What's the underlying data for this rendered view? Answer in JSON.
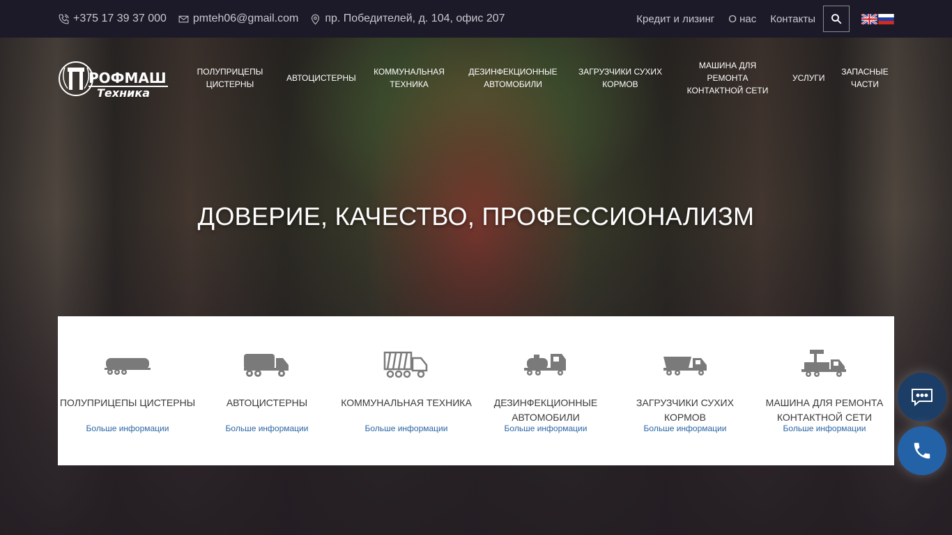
{
  "topbar": {
    "phone": "+375 17 39 37 000",
    "email": "pmteh06@gmail.com",
    "address": "пр. Победителей, д. 104, офис 207",
    "links": [
      "Кредит и лизинг",
      "О нас",
      "Контакты"
    ]
  },
  "nav": {
    "items": [
      "ПОЛУПРИЦЕПЫ ЦИСТЕРНЫ",
      "АВТОЦИСТЕРНЫ",
      "КОММУНАЛЬНАЯ ТЕХНИКА",
      "ДЕЗИНФЕКЦИОННЫЕ АВТОМОБИЛИ",
      "ЗАГРУЗЧИКИ СУХИХ КОРМОВ",
      "МАШИНА ДЛЯ РЕМОНТА КОНТАКТНОЙ СЕТИ",
      "УСЛУГИ",
      "ЗАПАСНЫЕ ЧАСТИ"
    ]
  },
  "logo": {
    "text_top": "РОФМАШ",
    "text_bottom": "Техника"
  },
  "hero": {
    "headline": "ДОВЕРИЕ, КАЧЕСТВО, ПРОФЕССИОНАЛИЗМ"
  },
  "categories": [
    {
      "title": "ПОЛУПРИЦЕПЫ ЦИСТЕРНЫ",
      "more": "Больше информации",
      "icon": "semi-trailer-tanker-icon"
    },
    {
      "title": "АВТОЦИСТЕРНЫ",
      "more": "Больше информации",
      "icon": "tanker-truck-icon"
    },
    {
      "title": "КОММУНАЛЬНАЯ ТЕХНИКА",
      "more": "Больше информации",
      "icon": "garbage-truck-icon"
    },
    {
      "title": "ДЕЗИНФЕКЦИОННЫЕ АВТОМОБИЛИ",
      "more": "Больше информации",
      "icon": "disinfection-truck-icon"
    },
    {
      "title": "ЗАГРУЗЧИКИ СУХИХ КОРМОВ",
      "more": "Больше информации",
      "icon": "feed-loader-truck-icon"
    },
    {
      "title": "МАШИНА ДЛЯ РЕМОНТА КОНТАКТНОЙ СЕТИ",
      "more": "Больше информации",
      "icon": "repair-platform-truck-icon"
    }
  ],
  "colors": {
    "topbar_bg": "#1c1a28",
    "link_blue": "#2a65a3",
    "fab_chat": "#1b3d66",
    "fab_call": "#2462a8"
  }
}
